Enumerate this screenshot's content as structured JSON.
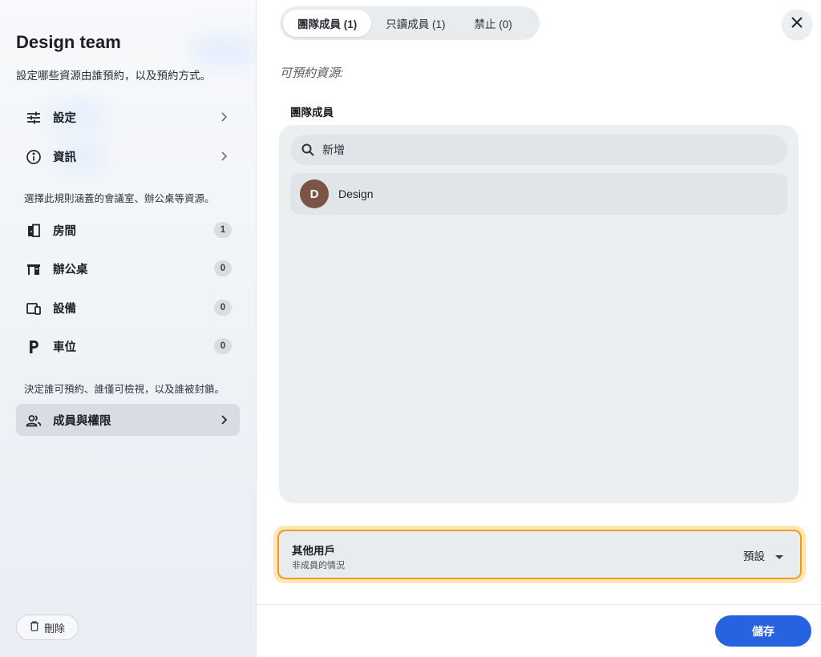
{
  "sidebar": {
    "title": "Design team",
    "subtitle": "設定哪些資源由誰預約，以及預約方式。",
    "items_top": [
      {
        "label": "設定",
        "icon": "sliders-icon"
      },
      {
        "label": "資訊",
        "icon": "info-icon"
      }
    ],
    "resources_note": "選擇此規則涵蓋的會議室、辦公桌等資源。",
    "resources": [
      {
        "label": "房間",
        "icon": "door-icon",
        "count": "1"
      },
      {
        "label": "辦公桌",
        "icon": "desk-icon",
        "count": "0"
      },
      {
        "label": "設備",
        "icon": "devices-icon",
        "count": "0"
      },
      {
        "label": "車位",
        "icon": "parking-icon",
        "count": "0"
      }
    ],
    "access_note": "決定誰可預約、誰僅可檢視，以及誰被封鎖。",
    "members_item": {
      "label": "成員與權限",
      "icon": "people-icon"
    },
    "delete_label": "刪除"
  },
  "main": {
    "tabs": [
      {
        "label": "團隊成員 (1)",
        "active": true
      },
      {
        "label": "只讀成員 (1)",
        "active": false
      },
      {
        "label": "禁止 (0)",
        "active": false
      }
    ],
    "section_title": "可預約資源:",
    "group_label": "團隊成員",
    "search_placeholder": "新增",
    "members": [
      {
        "initial": "D",
        "name": "Design",
        "avatar_color": "#7b5446"
      }
    ],
    "others": {
      "title": "其他用戶",
      "subtitle": "非成員的情況",
      "value": "預設"
    },
    "save_label": "儲存"
  },
  "colors": {
    "accent": "#2763e0",
    "highlight_border": "#f39a1d",
    "highlight_glow": "#fde6b8"
  }
}
